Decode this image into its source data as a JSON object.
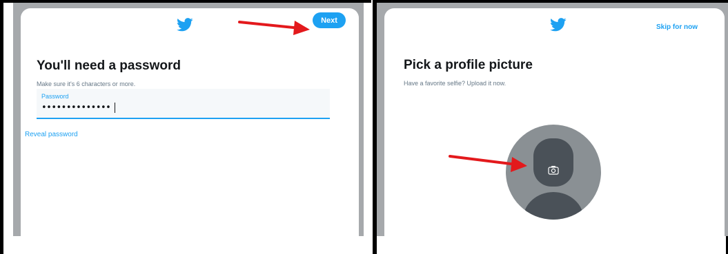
{
  "left": {
    "next_label": "Next",
    "heading": "You'll need a password",
    "subtext": "Make sure it's 6 characters or more.",
    "password_label": "Password",
    "password_value": "••••••••••••••",
    "reveal_label": "Reveal password"
  },
  "right": {
    "skip_label": "Skip for now",
    "heading": "Pick a profile picture",
    "subtext": "Have a favorite selfie? Upload it now."
  },
  "colors": {
    "accent": "#1da1f2",
    "annotation_arrow": "#e3191c",
    "frame_gray": "#a6a9ac",
    "avatar_gray": "#8a9094",
    "avatar_dark": "#4a5158"
  },
  "icons": [
    "twitter-bird-icon",
    "camera-icon",
    "red-arrow-annotation"
  ]
}
